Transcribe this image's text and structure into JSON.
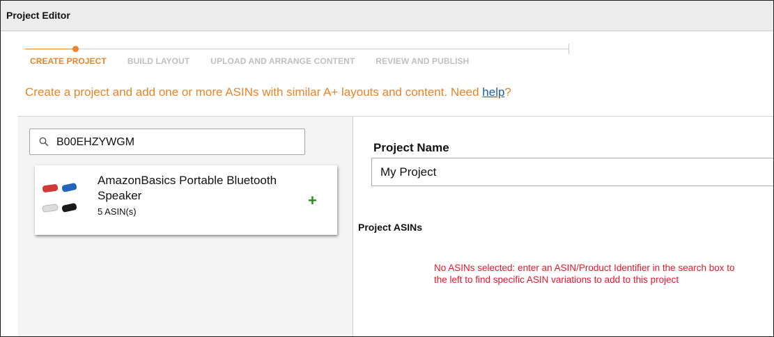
{
  "window": {
    "title": "Project Editor"
  },
  "steps": [
    {
      "label": "CREATE PROJECT",
      "active": true
    },
    {
      "label": "BUILD LAYOUT",
      "active": false
    },
    {
      "label": "UPLOAD AND ARRANGE CONTENT",
      "active": false
    },
    {
      "label": "REVIEW AND PUBLISH",
      "active": false
    }
  ],
  "intro": {
    "text": "Create a project and add one or more ASINs with similar A+ layouts and content. Need ",
    "link_label": "help",
    "suffix": "?"
  },
  "search": {
    "value": "B00EHZYWGM",
    "icon": "search-icon"
  },
  "result": {
    "name": "AmazonBasics Portable Bluetooth Speaker",
    "asin_count": "5 ASIN(s)",
    "add_icon": "+",
    "thumb_colors": [
      "#d23a3a",
      "#2266b8",
      "#dcdcdc",
      "#1a1a1a"
    ]
  },
  "project": {
    "name_label": "Project Name",
    "name_value": "My Project",
    "asins_label": "Project ASINs",
    "empty_message": "No ASINs selected: enter an ASIN/Product Identifier in the search box to the left to find specific ASIN variations to add to this project"
  },
  "colors": {
    "accent": "#e8842b",
    "link": "#1b5fa8",
    "error": "#e8172a",
    "add": "#2b8a1c"
  }
}
